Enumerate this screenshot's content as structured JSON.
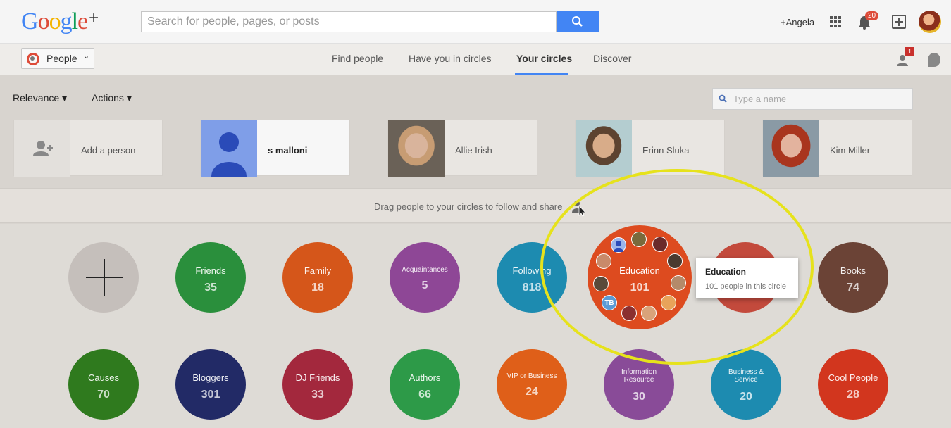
{
  "header": {
    "logo_text": "Google",
    "logo_plus": "+",
    "search_placeholder": "Search for people, pages, or posts",
    "username": "+Angela",
    "notification_count": "20"
  },
  "subnav": {
    "people_button": "People",
    "tabs": [
      {
        "label": "Find people"
      },
      {
        "label": "Have you in circles"
      },
      {
        "label": "Your circles"
      },
      {
        "label": "Discover"
      }
    ],
    "friend_request_count": "1"
  },
  "toolbar": {
    "sort_label": "Relevance",
    "actions_label": "Actions",
    "name_search_placeholder": "Type a name"
  },
  "people": [
    {
      "name": "Add a person"
    },
    {
      "name": "s malloni"
    },
    {
      "name": "Allie Irish"
    },
    {
      "name": "Erinn Sluka"
    },
    {
      "name": "Kim Miller"
    }
  ],
  "drag_hint": "Drag people to your circles to follow and share",
  "circles_row1": [
    {
      "name": "Friends",
      "count": "35",
      "color": "#2a8f3c"
    },
    {
      "name": "Family",
      "count": "18",
      "color": "#d5561a"
    },
    {
      "name": "Acquaintances",
      "count": "5",
      "color": "#8e4796"
    },
    {
      "name": "Following",
      "count": "818",
      "color": "#1d8bb0"
    },
    {
      "name": "Education",
      "count": "101",
      "color": "#dd4b1f"
    },
    {
      "name": "",
      "count": "",
      "color": "#c34a3c"
    },
    {
      "name": "Books",
      "count": "74",
      "color": "#6b4336"
    }
  ],
  "circles_row2": [
    {
      "name": "Causes",
      "count": "70",
      "color": "#2f7a1e"
    },
    {
      "name": "Bloggers",
      "count": "301",
      "color": "#222a66"
    },
    {
      "name": "DJ Friends",
      "count": "33",
      "color": "#a3283d"
    },
    {
      "name": "Authors",
      "count": "66",
      "color": "#2d9a48"
    },
    {
      "name": "VIP or Business",
      "count": "24",
      "color": "#df5f19"
    },
    {
      "name": "Information Resource",
      "count": "30",
      "color": "#894b98"
    },
    {
      "name": "Business & Service",
      "count": "20",
      "color": "#1d8bb0"
    },
    {
      "name": "Cool People",
      "count": "28",
      "color": "#d2361e"
    }
  ],
  "tooltip": {
    "title": "Education",
    "subtitle": "101 people in this circle"
  },
  "education_badge": "TB"
}
